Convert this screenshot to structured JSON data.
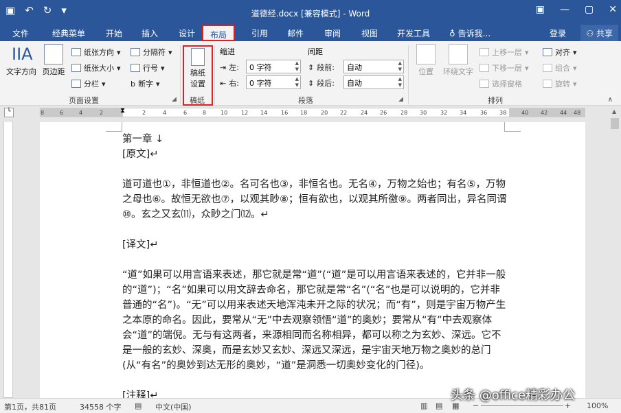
{
  "window": {
    "title": "道德经.docx [兼容模式] - Word",
    "qat": [
      "save-icon",
      "undo-icon",
      "redo-icon",
      "customize-icon"
    ],
    "controls": [
      "ribbon-display-icon",
      "minimize-icon",
      "maximize-icon",
      "close-icon"
    ]
  },
  "tabs": [
    "文件",
    "经典菜单",
    "开始",
    "插入",
    "设计",
    "布局",
    "引用",
    "邮件",
    "审阅",
    "视图",
    "开发工具"
  ],
  "tell_me": "告诉我...",
  "signin": "登录",
  "share": "共享",
  "ribbon": {
    "text_direction": "文字方向",
    "margins": "页边距",
    "orientation": "纸张方向",
    "size": "纸张大小",
    "columns": "分栏",
    "breaks": "分隔符",
    "line_numbers": "行号",
    "hyphenation": "断字",
    "page_setup_group": "页面设置",
    "draft_paper_setup_line1": "稿纸",
    "draft_paper_setup_line2": "设置",
    "draft_paper_group": "稿纸",
    "indent_label": "缩进",
    "spacing_label": "间距",
    "left_label": "左:",
    "left_value": "0 字符",
    "right_label": "右:",
    "right_value": "0 字符",
    "before_label": "段前:",
    "before_value": "自动",
    "after_label": "段后:",
    "after_value": "自动",
    "paragraph_group": "段落",
    "position": "位置",
    "wrap_text": "环绕文字",
    "bring_forward": "上移一层",
    "send_backward": "下移一层",
    "selection_pane": "选择窗格",
    "align": "对齐",
    "group": "组合",
    "rotate": "旋转",
    "arrange_group": "排列"
  },
  "ruler": [
    "8",
    "6",
    "4",
    "2",
    "2",
    "4",
    "6",
    "8",
    "10",
    "12",
    "14",
    "16",
    "18",
    "20",
    "22",
    "24",
    "26",
    "28",
    "30",
    "32",
    "34",
    "36",
    "38",
    "40",
    "42",
    "44",
    "48"
  ],
  "document": {
    "paragraphs": [
      "第一章 ↓",
      "[原文]↵",
      "",
      "道可道也①，非恒道也②。名可名也③，非恒名也。无名④，万物之始也；有名⑤，万物之母也⑥。故恒无欲也⑦，以观其眇⑧；恒有欲也，以观其所徼⑨。两者同出，异名同谓⑩。玄之又玄⑾，众眇之门⑿。↵",
      "",
      "[译文]↵",
      "",
      "“道”如果可以用言语来表述，那它就是常“道”(“道”是可以用言语来表述的，它并非一般的“道”)；“名”如果可以用文辞去命名，那它就是常“名”(“名”也是可以说明的，它并非普通的“名”)。“无”可以用来表述天地浑沌未开之际的状况；而“有”，则是宇宙万物产生之本原的命名。因此，要常从“无”中去观察领悟“道”的奥妙；要常从“有”中去观察体会“道”的端倪。无与有这两者，来源相同而名称相异，都可以称之为玄妙、深远。它不是一般的玄妙、深奥，而是玄妙又玄妙、深远又深远，是宇宙天地万物之奥妙的总门(从“有名”的奥妙到达无形的奥妙，“道”是洞悉一切奥妙变化的门径)。",
      "",
      "[注释]↵"
    ]
  },
  "status": {
    "page": "第1页，共81页",
    "words": "34558 个字",
    "language": "中文(中国)",
    "zoom": "100%"
  },
  "watermark": "头条 @office精彩办公"
}
